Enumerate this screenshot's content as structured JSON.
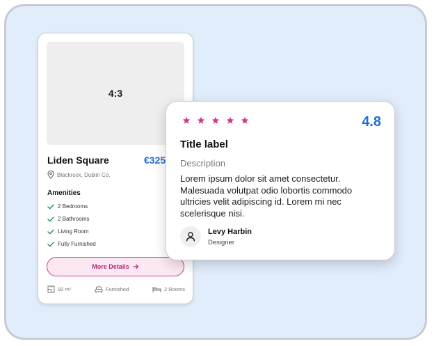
{
  "listing": {
    "image_placeholder": "4:3",
    "title": "Liden Square",
    "price": "€325",
    "location": "Blackrock, Dublin Co.",
    "amenities_heading": "Amenities",
    "amenities": [
      "2 Bedrooms",
      "2 Bathrooms",
      "Living Room",
      "Fully Furnished"
    ],
    "cta_label": "More Details",
    "stats": {
      "area": "92 m²",
      "furnished": "Furnished",
      "rooms": "2 Rooms"
    }
  },
  "review": {
    "stars": 5,
    "rating": "4.8",
    "title": "Title label",
    "description": "Description",
    "body": "Lorem ipsum dolor sit amet consectetur. Malesuada volutpat odio lobortis commodo ultricies velit adipiscing id. Lorem mi nec scelerisque nisi.",
    "author_name": "Levy Harbin",
    "author_role": "Designer"
  },
  "colors": {
    "accent_blue": "#1f6fd1",
    "accent_pink": "#d1358e",
    "check_green": "#1e8a57",
    "background": "#e2edfb"
  },
  "icons": {
    "location": "map-pin-icon",
    "amenity": "check-icon",
    "cta": "arrow-right-icon",
    "area": "floor-plan-icon",
    "furnished": "sofa-icon",
    "rooms": "bed-icon",
    "star": "star-icon",
    "avatar": "user-icon"
  }
}
